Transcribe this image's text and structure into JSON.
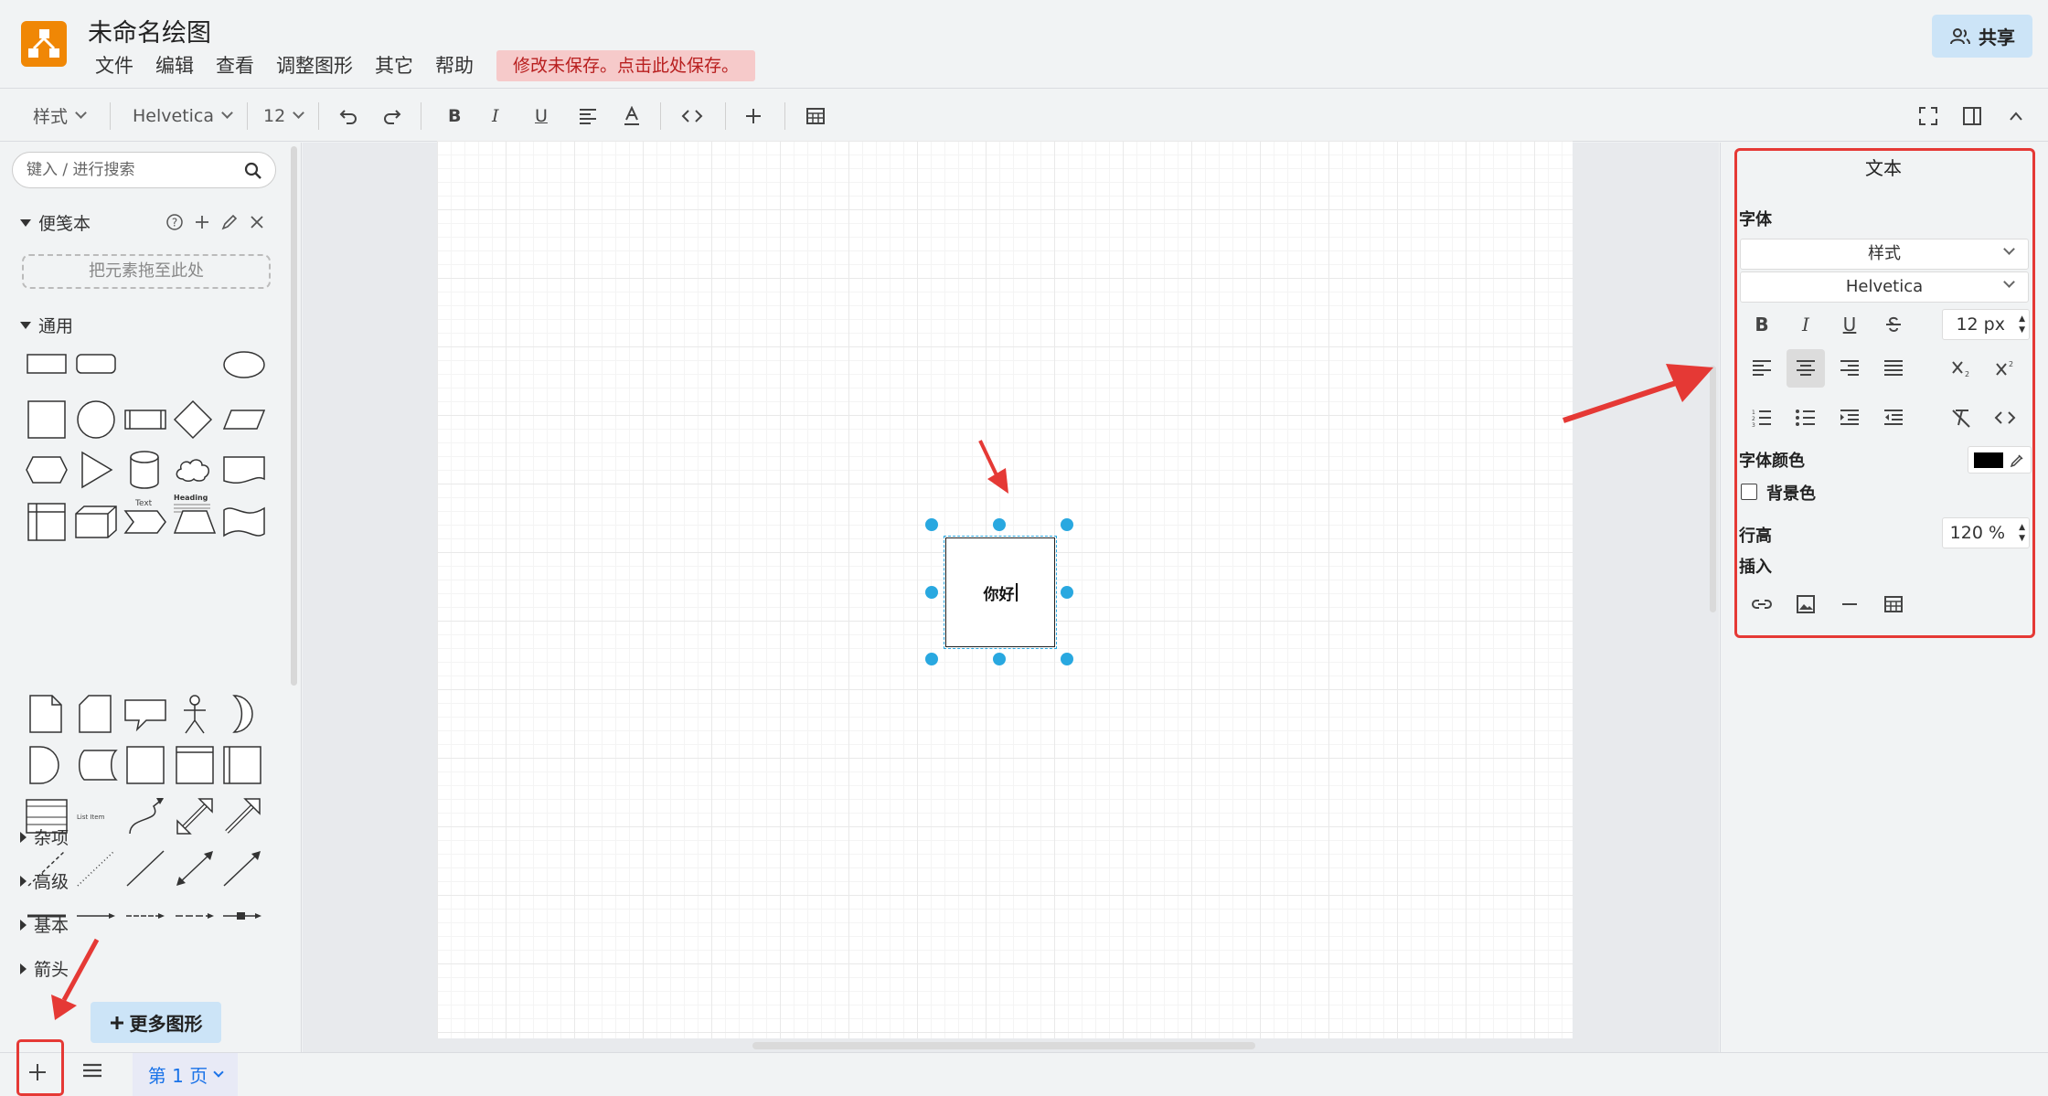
{
  "app": {
    "title": "未命名绘图",
    "menu": [
      "文件",
      "编辑",
      "查看",
      "调整图形",
      "其它",
      "帮助"
    ],
    "save_notice": "修改未保存。点击此处保存。",
    "share_label": "共享",
    "brand_color": "#f08705"
  },
  "toolbar": {
    "style_label": "样式",
    "font_family": "Helvetica",
    "font_size": "12"
  },
  "sidebar": {
    "search_placeholder": "键入 / 进行搜索",
    "scratchpad_title": "便笺本",
    "dropzone_text": "把元素拖至此处",
    "general_title": "通用",
    "sections": [
      "杂项",
      "高级",
      "基本",
      "箭头"
    ],
    "more_shapes_label": "更多图形",
    "shape_text_labels": {
      "text": "Text",
      "heading": "Heading",
      "list_item": "List Item"
    }
  },
  "canvas": {
    "selected_shape_text": "你好"
  },
  "format_panel": {
    "title": "文本",
    "font_heading": "字体",
    "style_select": "样式",
    "font_select": "Helvetica",
    "font_size_value": "12 px",
    "font_color_label": "字体颜色",
    "font_color": "#000000",
    "background_label": "背景色",
    "background_checked": false,
    "line_height_label": "行高",
    "line_height_value": "120 %",
    "insert_label": "插入"
  },
  "bottom": {
    "page_tab_label": "第 1 页"
  },
  "annotation_color": "#e53935"
}
